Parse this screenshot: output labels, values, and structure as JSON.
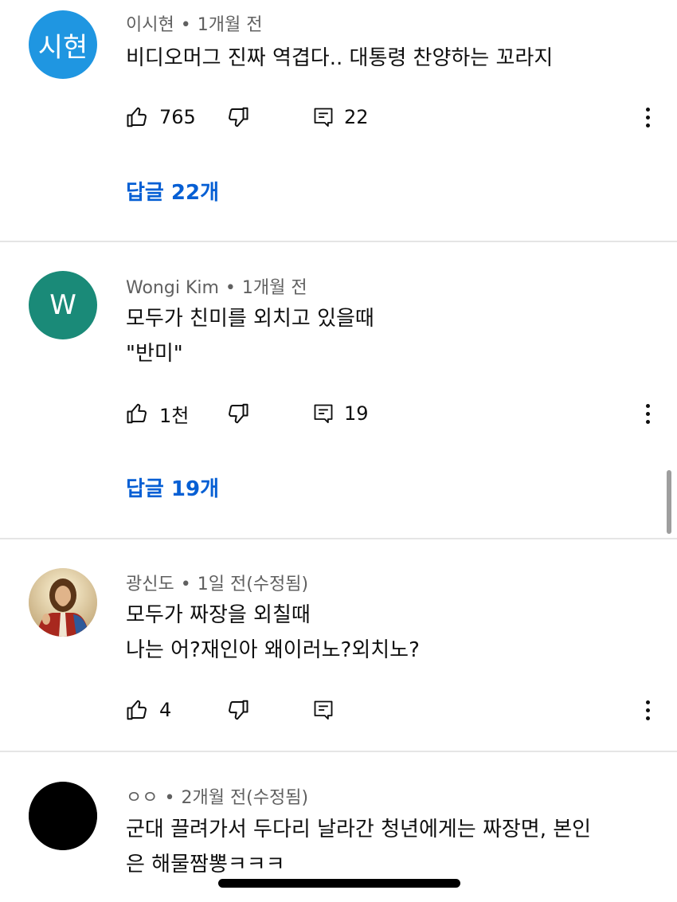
{
  "colors": {
    "link_blue": "#065fd4",
    "meta_gray": "#606060",
    "avatar_blue": "#1f96e1",
    "avatar_teal": "#1a8a78"
  },
  "comments": [
    {
      "avatar_text": "시현",
      "author": "이시현",
      "dot": "•",
      "time": "1개월 전",
      "lines": [
        "비디오머그 진짜 역겹다.. 대통령 찬양하는 꼬라지"
      ],
      "likes": "765",
      "reply_count": "22",
      "replies_label": "답글 22개"
    },
    {
      "avatar_text": "W",
      "author": "Wongi Kim",
      "dot": "•",
      "time": "1개월 전",
      "lines": [
        "모두가 친미를 외치고 있을때",
        "\"반미\""
      ],
      "likes": "1천",
      "reply_count": "19",
      "replies_label": "답글 19개"
    },
    {
      "avatar_icon": "jesus-portrait-avatar",
      "author": "광신도",
      "dot": "•",
      "time": "1일 전(수정됨)",
      "lines": [
        "모두가 짜장을 외칠때",
        "나는 어?재인아 왜이러노?외치노?"
      ],
      "likes": "4",
      "reply_count": ""
    },
    {
      "avatar_icon": "black-circle-avatar",
      "author": "ㅇㅇ",
      "dot": "•",
      "time": "2개월 전(수정됨)",
      "lines": [
        "군대 끌려가서 두다리 날라간 청년에게는 짜장면, 본인",
        "은 해물짬뽕ㅋㅋㅋ"
      ]
    }
  ]
}
